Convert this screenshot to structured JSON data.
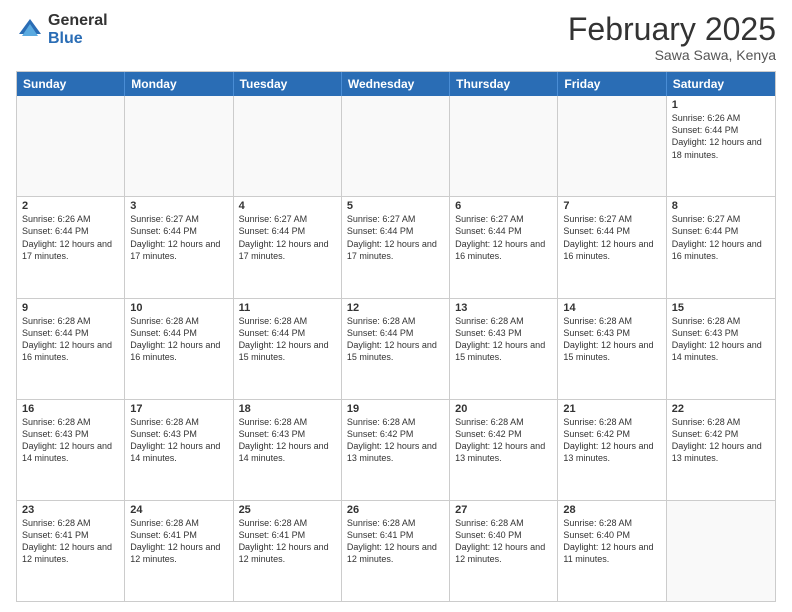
{
  "logo": {
    "general": "General",
    "blue": "Blue"
  },
  "header": {
    "month": "February 2025",
    "location": "Sawa Sawa, Kenya"
  },
  "weekdays": [
    "Sunday",
    "Monday",
    "Tuesday",
    "Wednesday",
    "Thursday",
    "Friday",
    "Saturday"
  ],
  "weeks": [
    [
      {
        "day": "",
        "info": ""
      },
      {
        "day": "",
        "info": ""
      },
      {
        "day": "",
        "info": ""
      },
      {
        "day": "",
        "info": ""
      },
      {
        "day": "",
        "info": ""
      },
      {
        "day": "",
        "info": ""
      },
      {
        "day": "1",
        "info": "Sunrise: 6:26 AM\nSunset: 6:44 PM\nDaylight: 12 hours and 18 minutes."
      }
    ],
    [
      {
        "day": "2",
        "info": "Sunrise: 6:26 AM\nSunset: 6:44 PM\nDaylight: 12 hours and 17 minutes."
      },
      {
        "day": "3",
        "info": "Sunrise: 6:27 AM\nSunset: 6:44 PM\nDaylight: 12 hours and 17 minutes."
      },
      {
        "day": "4",
        "info": "Sunrise: 6:27 AM\nSunset: 6:44 PM\nDaylight: 12 hours and 17 minutes."
      },
      {
        "day": "5",
        "info": "Sunrise: 6:27 AM\nSunset: 6:44 PM\nDaylight: 12 hours and 17 minutes."
      },
      {
        "day": "6",
        "info": "Sunrise: 6:27 AM\nSunset: 6:44 PM\nDaylight: 12 hours and 16 minutes."
      },
      {
        "day": "7",
        "info": "Sunrise: 6:27 AM\nSunset: 6:44 PM\nDaylight: 12 hours and 16 minutes."
      },
      {
        "day": "8",
        "info": "Sunrise: 6:27 AM\nSunset: 6:44 PM\nDaylight: 12 hours and 16 minutes."
      }
    ],
    [
      {
        "day": "9",
        "info": "Sunrise: 6:28 AM\nSunset: 6:44 PM\nDaylight: 12 hours and 16 minutes."
      },
      {
        "day": "10",
        "info": "Sunrise: 6:28 AM\nSunset: 6:44 PM\nDaylight: 12 hours and 16 minutes."
      },
      {
        "day": "11",
        "info": "Sunrise: 6:28 AM\nSunset: 6:44 PM\nDaylight: 12 hours and 15 minutes."
      },
      {
        "day": "12",
        "info": "Sunrise: 6:28 AM\nSunset: 6:44 PM\nDaylight: 12 hours and 15 minutes."
      },
      {
        "day": "13",
        "info": "Sunrise: 6:28 AM\nSunset: 6:43 PM\nDaylight: 12 hours and 15 minutes."
      },
      {
        "day": "14",
        "info": "Sunrise: 6:28 AM\nSunset: 6:43 PM\nDaylight: 12 hours and 15 minutes."
      },
      {
        "day": "15",
        "info": "Sunrise: 6:28 AM\nSunset: 6:43 PM\nDaylight: 12 hours and 14 minutes."
      }
    ],
    [
      {
        "day": "16",
        "info": "Sunrise: 6:28 AM\nSunset: 6:43 PM\nDaylight: 12 hours and 14 minutes."
      },
      {
        "day": "17",
        "info": "Sunrise: 6:28 AM\nSunset: 6:43 PM\nDaylight: 12 hours and 14 minutes."
      },
      {
        "day": "18",
        "info": "Sunrise: 6:28 AM\nSunset: 6:43 PM\nDaylight: 12 hours and 14 minutes."
      },
      {
        "day": "19",
        "info": "Sunrise: 6:28 AM\nSunset: 6:42 PM\nDaylight: 12 hours and 13 minutes."
      },
      {
        "day": "20",
        "info": "Sunrise: 6:28 AM\nSunset: 6:42 PM\nDaylight: 12 hours and 13 minutes."
      },
      {
        "day": "21",
        "info": "Sunrise: 6:28 AM\nSunset: 6:42 PM\nDaylight: 12 hours and 13 minutes."
      },
      {
        "day": "22",
        "info": "Sunrise: 6:28 AM\nSunset: 6:42 PM\nDaylight: 12 hours and 13 minutes."
      }
    ],
    [
      {
        "day": "23",
        "info": "Sunrise: 6:28 AM\nSunset: 6:41 PM\nDaylight: 12 hours and 12 minutes."
      },
      {
        "day": "24",
        "info": "Sunrise: 6:28 AM\nSunset: 6:41 PM\nDaylight: 12 hours and 12 minutes."
      },
      {
        "day": "25",
        "info": "Sunrise: 6:28 AM\nSunset: 6:41 PM\nDaylight: 12 hours and 12 minutes."
      },
      {
        "day": "26",
        "info": "Sunrise: 6:28 AM\nSunset: 6:41 PM\nDaylight: 12 hours and 12 minutes."
      },
      {
        "day": "27",
        "info": "Sunrise: 6:28 AM\nSunset: 6:40 PM\nDaylight: 12 hours and 12 minutes."
      },
      {
        "day": "28",
        "info": "Sunrise: 6:28 AM\nSunset: 6:40 PM\nDaylight: 12 hours and 11 minutes."
      },
      {
        "day": "",
        "info": ""
      }
    ]
  ]
}
